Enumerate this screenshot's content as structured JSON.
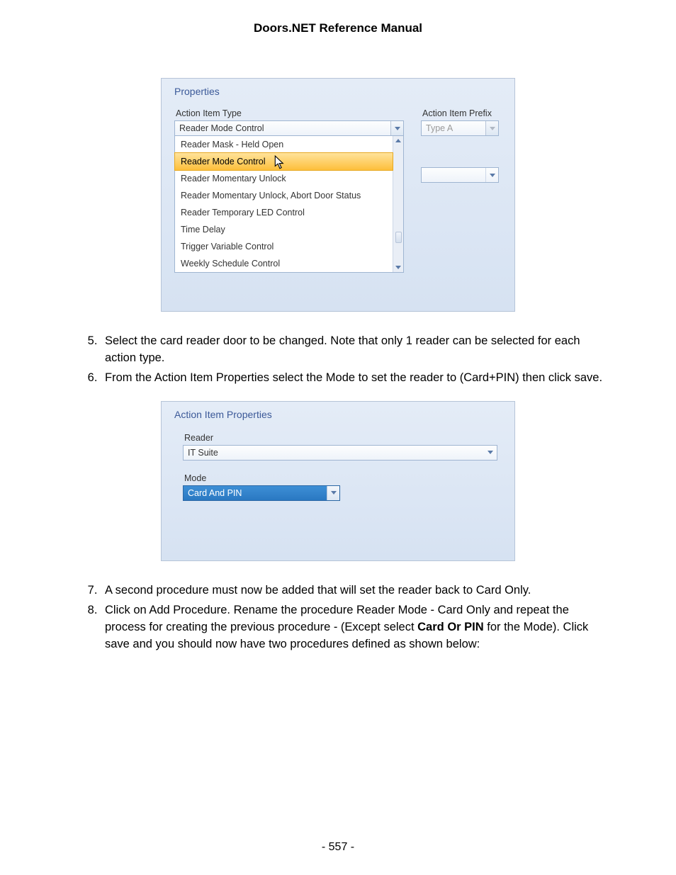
{
  "doc_title": "Doors.NET Reference Manual",
  "page_number": "- 557 -",
  "panel1": {
    "title": "Properties",
    "action_item_type_label": "Action Item Type",
    "action_item_type_value": "Reader Mode Control",
    "action_item_prefix_label": "Action Item Prefix",
    "action_item_prefix_value": "Type A",
    "list_items": [
      "Reader Mask - Held Open",
      "Reader Mode Control",
      "Reader Momentary Unlock",
      "Reader Momentary Unlock, Abort Door Status",
      "Reader Temporary LED Control",
      "Time Delay",
      "Trigger Variable Control",
      "Weekly Schedule Control"
    ],
    "highlight_index": 1
  },
  "steps_a": {
    "start": 5,
    "items": [
      "Select the card reader door to be changed. Note that only 1 reader can be selected for each action type.",
      "From the Action Item Properties select the Mode to set the reader to (Card+PIN) then click save."
    ]
  },
  "panel2": {
    "title": "Action Item Properties",
    "reader_label": "Reader",
    "reader_value": "IT Suite",
    "mode_label": "Mode",
    "mode_value": "Card And PIN"
  },
  "steps_b": {
    "start": 7,
    "items": [
      {
        "text": "A second procedure must now be added that will set the reader back to Card Only."
      },
      {
        "prefix": "Click on Add Procedure. Rename the procedure Reader Mode - Card Only and repeat the process for creating the previous procedure - (Except select ",
        "bold": "Card Or PIN",
        "suffix": " for the Mode). Click save and you should now have two procedures defined as shown below:"
      }
    ]
  }
}
